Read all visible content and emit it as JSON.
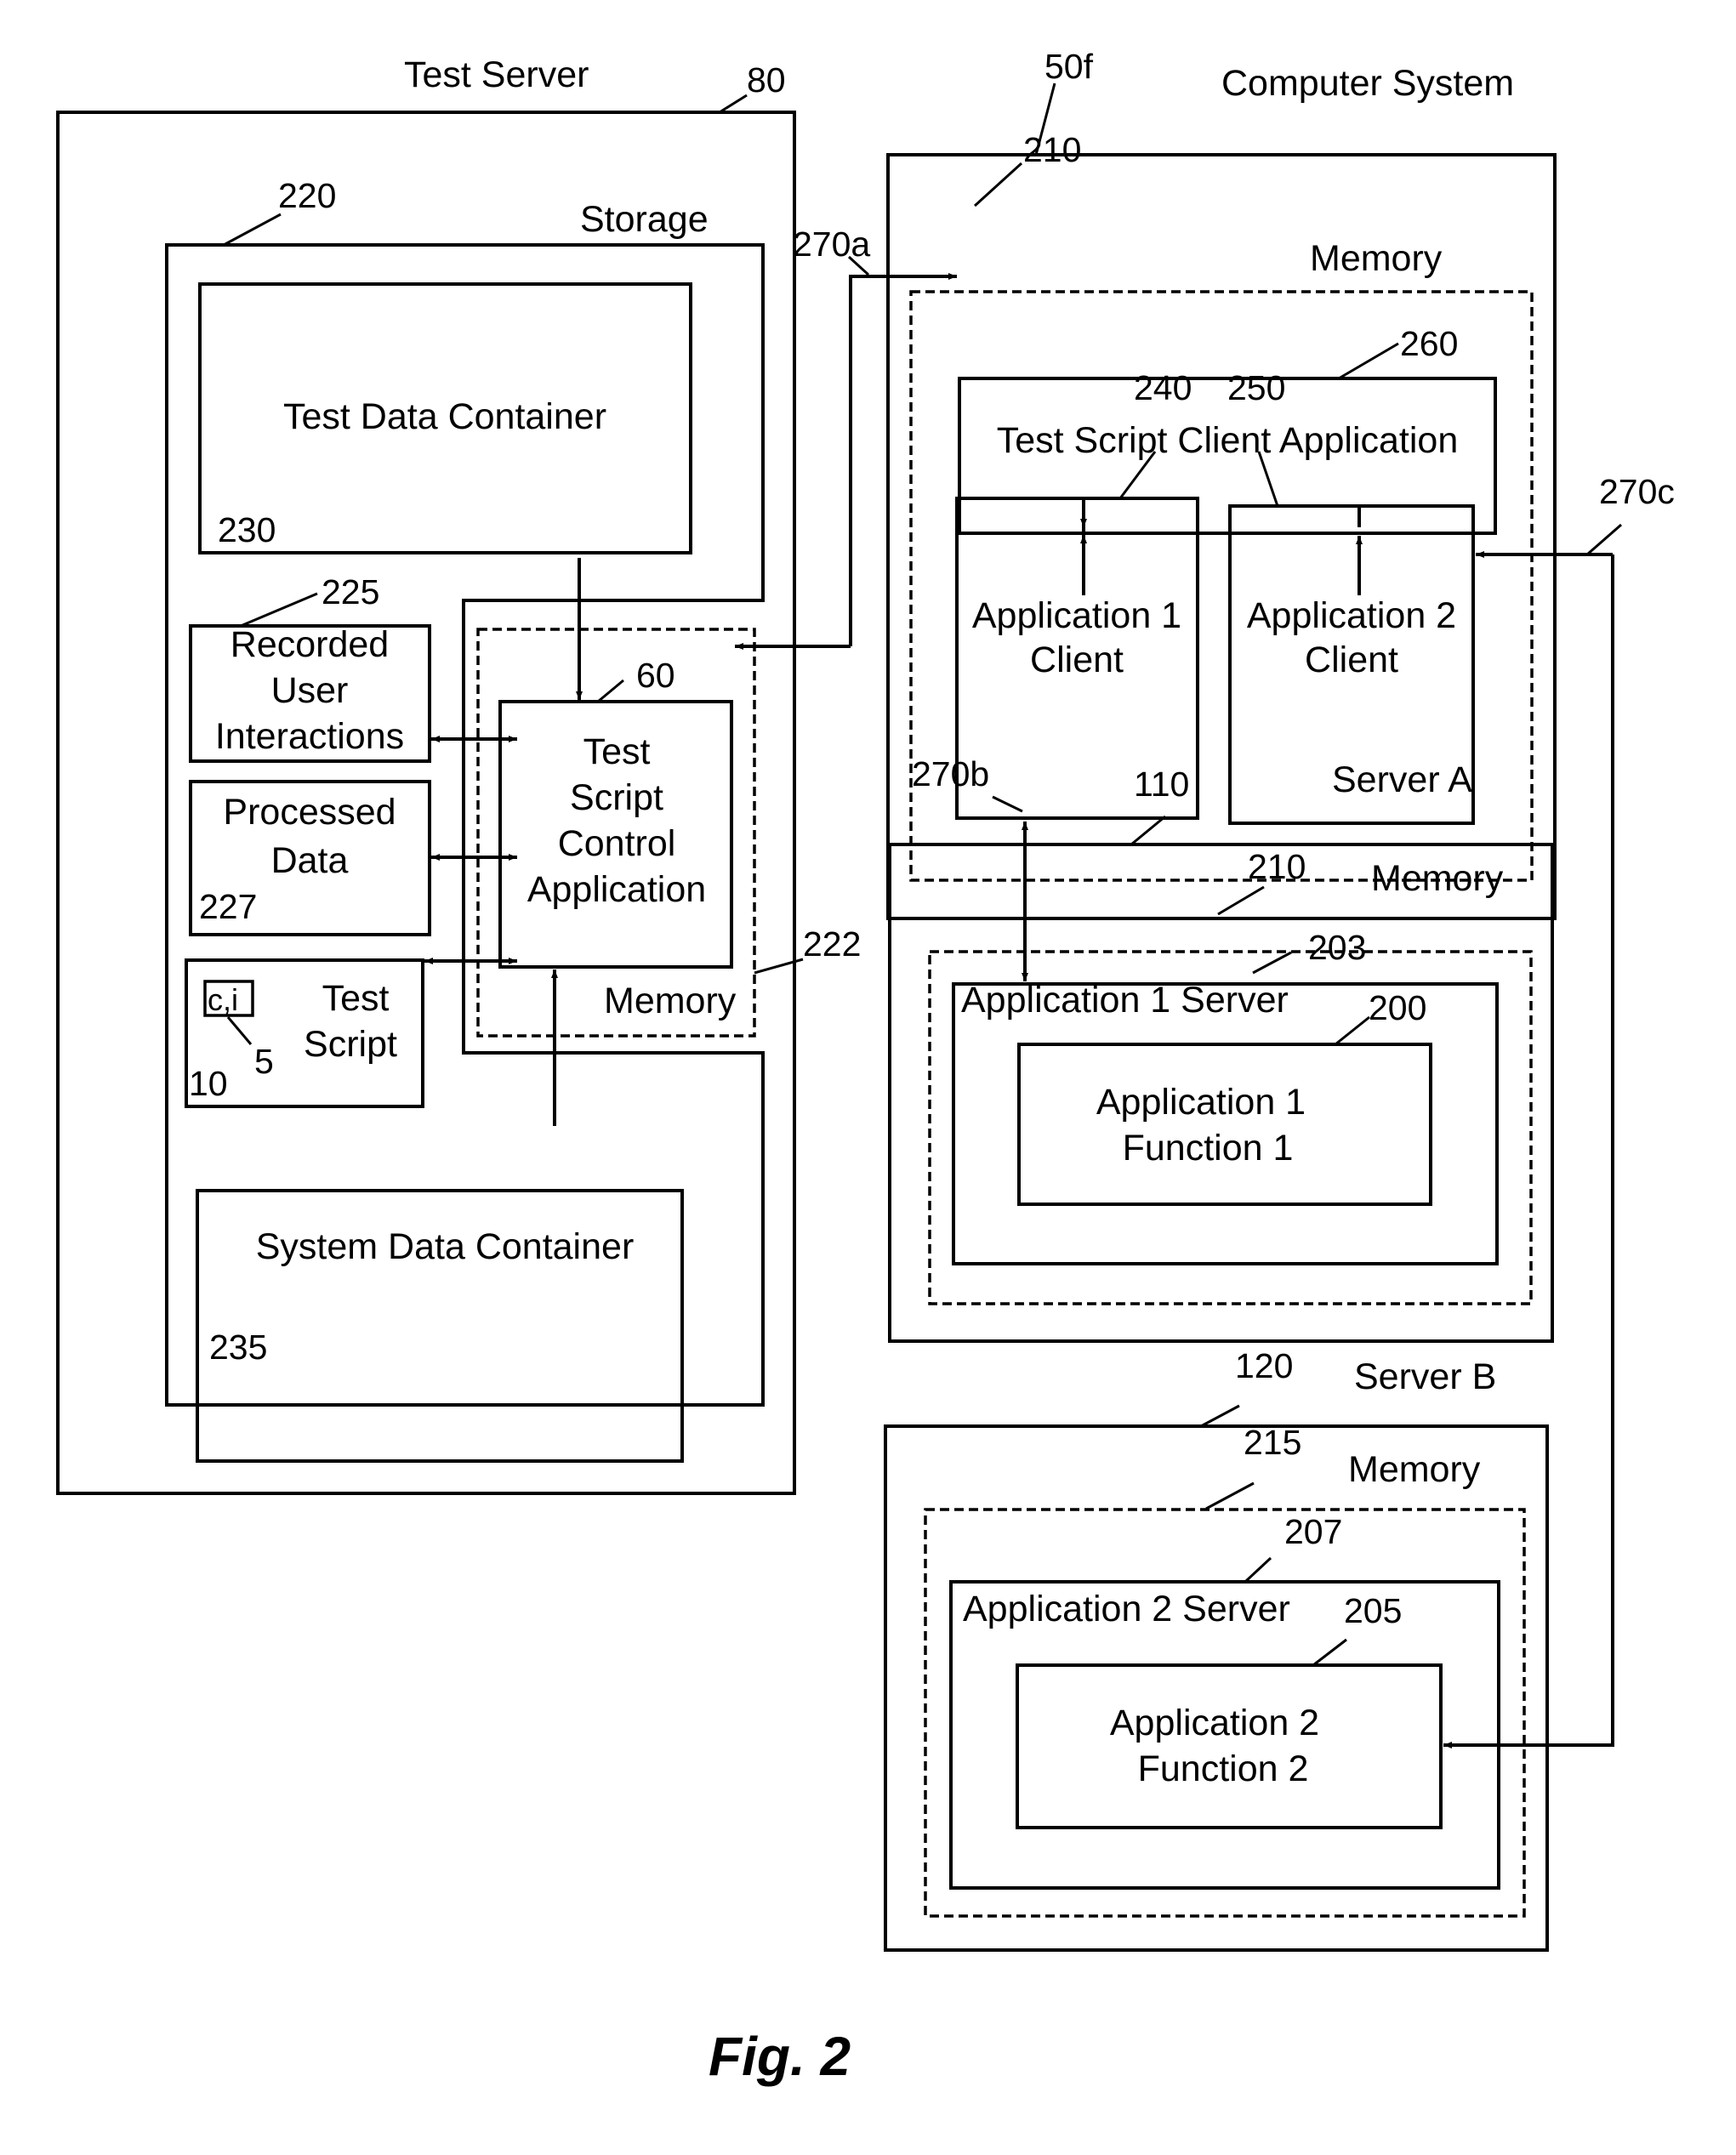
{
  "figure": {
    "caption": "Fig. 2",
    "colors": {
      "ink": "#000000",
      "background": "#ffffff"
    }
  },
  "test_server": {
    "title": "Test Server",
    "ref": "80",
    "storage": {
      "title": "Storage",
      "ref": "220",
      "test_data_container": {
        "label": "Test Data Container",
        "ref": "230"
      },
      "recorded_user_interactions": {
        "lines": [
          "Recorded",
          "User",
          "Interactions"
        ],
        "ref": "225"
      },
      "processed_data": {
        "lines": [
          "Processed",
          "Data"
        ],
        "ref": "227"
      },
      "test_script": {
        "lines": [
          "Test",
          "Script"
        ],
        "ref": "10",
        "inner_box": "c,i",
        "inner_ref": "5"
      },
      "system_data_container": {
        "label": "System Data Container",
        "ref": "235"
      }
    },
    "memory": {
      "title": "Memory",
      "ref": "222",
      "test_script_control_application": {
        "lines": [
          "Test",
          "Script",
          "Control",
          "Application"
        ],
        "ref": "60"
      }
    }
  },
  "computer_system": {
    "title": "Computer System",
    "ref": "50f",
    "memory": {
      "title": "Memory",
      "ref": "210",
      "test_script_client_application": {
        "label": "Test Script Client Application",
        "ref": "260"
      },
      "application_1_client": {
        "lines": [
          "Application 1",
          "Client"
        ],
        "ref": "240"
      },
      "application_2_client": {
        "lines": [
          "Application 2",
          "Client"
        ],
        "ref": "250"
      }
    }
  },
  "server_a": {
    "title": "Server A",
    "ref": "110",
    "memory": {
      "title": "Memory",
      "ref": "210",
      "application_server": {
        "label": "Application 1 Server",
        "ref": "203"
      },
      "application_function": {
        "lines": [
          "Application 1",
          "Function 1"
        ],
        "ref": "200"
      }
    }
  },
  "server_b": {
    "title": "Server B",
    "ref": "120",
    "memory": {
      "title": "Memory",
      "ref": "215",
      "application_server": {
        "label": "Application 2 Server",
        "ref": "207"
      },
      "application_function": {
        "lines": [
          "Application 2",
          "Function 2"
        ],
        "ref": "205"
      }
    }
  },
  "connections": {
    "link_a": {
      "ref": "270a",
      "from": "Test Script Control Application",
      "to": "Test Script Client Application"
    },
    "link_b": {
      "ref": "270b",
      "from": "Application 1 Client",
      "to": "Application 1 Server"
    },
    "link_c": {
      "ref": "270c",
      "from": "Application 2 Function 2",
      "to": "Application 2 Client"
    }
  }
}
